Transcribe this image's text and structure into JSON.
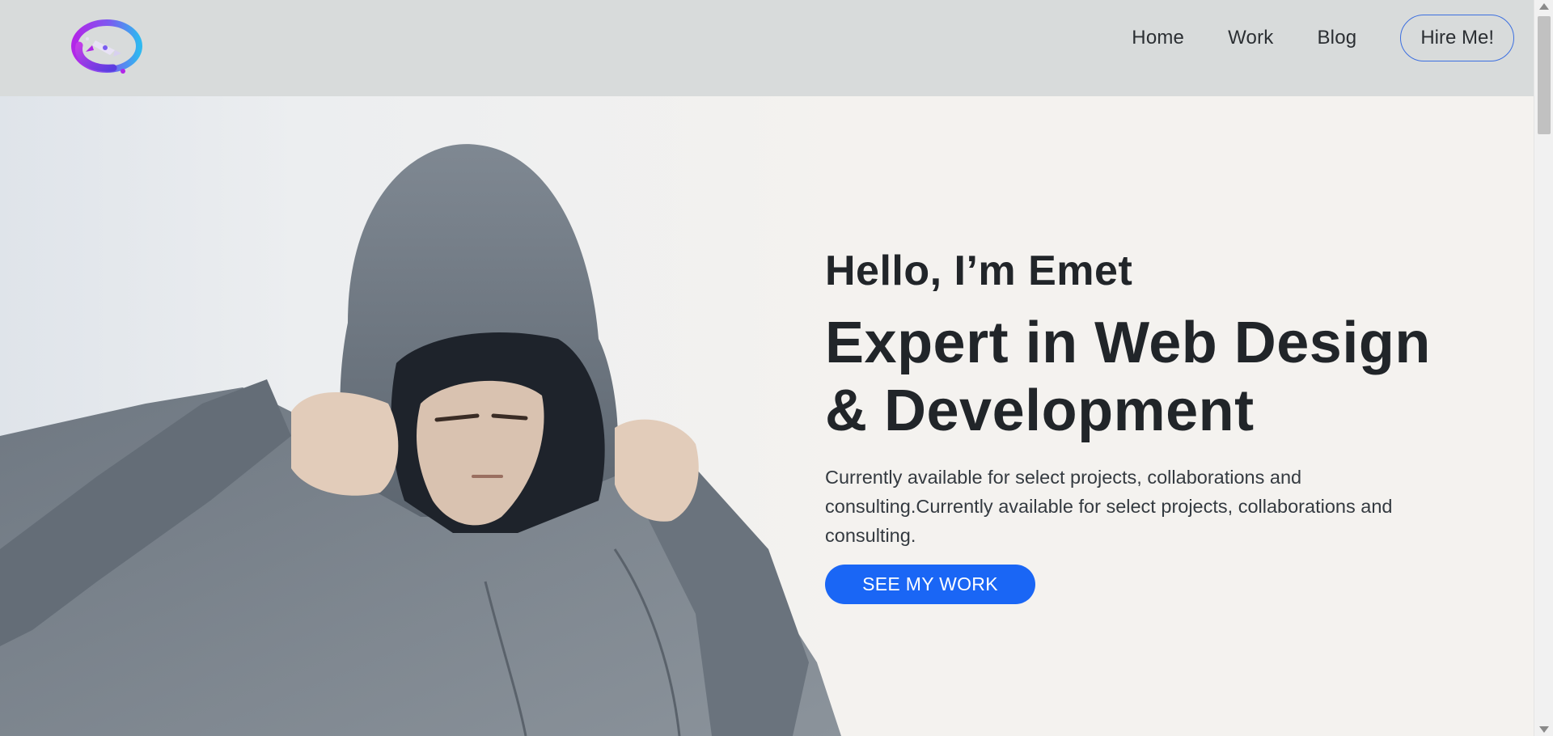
{
  "nav": {
    "home": "Home",
    "work": "Work",
    "blog": "Blog",
    "hire": "Hire Me!"
  },
  "hero": {
    "greeting": "Hello, I’m Emet",
    "headline": "Expert in Web Design & Development",
    "description": "Currently available for select projects, collaborations and consulting.Currently available for select projects, collaborations and consulting.",
    "cta": "SEE MY WORK"
  },
  "colors": {
    "header_bg": "#d8dbdb",
    "page_bg": "#f4f2ef",
    "accent": "#1a66f5",
    "hire_border": "#3c6fe0",
    "logo_gradient_start": "#b226e8",
    "logo_gradient_end": "#2fb8f0"
  },
  "icons": {
    "logo": "rocket-orbit-logo"
  }
}
